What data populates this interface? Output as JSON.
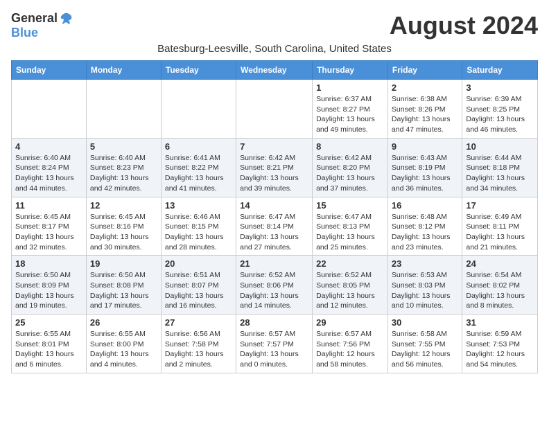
{
  "header": {
    "logo_general": "General",
    "logo_blue": "Blue",
    "month_title": "August 2024",
    "location": "Batesburg-Leesville, South Carolina, United States"
  },
  "days_of_week": [
    "Sunday",
    "Monday",
    "Tuesday",
    "Wednesday",
    "Thursday",
    "Friday",
    "Saturday"
  ],
  "weeks": [
    [
      {
        "day": "",
        "info": ""
      },
      {
        "day": "",
        "info": ""
      },
      {
        "day": "",
        "info": ""
      },
      {
        "day": "",
        "info": ""
      },
      {
        "day": "1",
        "info": "Sunrise: 6:37 AM\nSunset: 8:27 PM\nDaylight: 13 hours\nand 49 minutes."
      },
      {
        "day": "2",
        "info": "Sunrise: 6:38 AM\nSunset: 8:26 PM\nDaylight: 13 hours\nand 47 minutes."
      },
      {
        "day": "3",
        "info": "Sunrise: 6:39 AM\nSunset: 8:25 PM\nDaylight: 13 hours\nand 46 minutes."
      }
    ],
    [
      {
        "day": "4",
        "info": "Sunrise: 6:40 AM\nSunset: 8:24 PM\nDaylight: 13 hours\nand 44 minutes."
      },
      {
        "day": "5",
        "info": "Sunrise: 6:40 AM\nSunset: 8:23 PM\nDaylight: 13 hours\nand 42 minutes."
      },
      {
        "day": "6",
        "info": "Sunrise: 6:41 AM\nSunset: 8:22 PM\nDaylight: 13 hours\nand 41 minutes."
      },
      {
        "day": "7",
        "info": "Sunrise: 6:42 AM\nSunset: 8:21 PM\nDaylight: 13 hours\nand 39 minutes."
      },
      {
        "day": "8",
        "info": "Sunrise: 6:42 AM\nSunset: 8:20 PM\nDaylight: 13 hours\nand 37 minutes."
      },
      {
        "day": "9",
        "info": "Sunrise: 6:43 AM\nSunset: 8:19 PM\nDaylight: 13 hours\nand 36 minutes."
      },
      {
        "day": "10",
        "info": "Sunrise: 6:44 AM\nSunset: 8:18 PM\nDaylight: 13 hours\nand 34 minutes."
      }
    ],
    [
      {
        "day": "11",
        "info": "Sunrise: 6:45 AM\nSunset: 8:17 PM\nDaylight: 13 hours\nand 32 minutes."
      },
      {
        "day": "12",
        "info": "Sunrise: 6:45 AM\nSunset: 8:16 PM\nDaylight: 13 hours\nand 30 minutes."
      },
      {
        "day": "13",
        "info": "Sunrise: 6:46 AM\nSunset: 8:15 PM\nDaylight: 13 hours\nand 28 minutes."
      },
      {
        "day": "14",
        "info": "Sunrise: 6:47 AM\nSunset: 8:14 PM\nDaylight: 13 hours\nand 27 minutes."
      },
      {
        "day": "15",
        "info": "Sunrise: 6:47 AM\nSunset: 8:13 PM\nDaylight: 13 hours\nand 25 minutes."
      },
      {
        "day": "16",
        "info": "Sunrise: 6:48 AM\nSunset: 8:12 PM\nDaylight: 13 hours\nand 23 minutes."
      },
      {
        "day": "17",
        "info": "Sunrise: 6:49 AM\nSunset: 8:11 PM\nDaylight: 13 hours\nand 21 minutes."
      }
    ],
    [
      {
        "day": "18",
        "info": "Sunrise: 6:50 AM\nSunset: 8:09 PM\nDaylight: 13 hours\nand 19 minutes."
      },
      {
        "day": "19",
        "info": "Sunrise: 6:50 AM\nSunset: 8:08 PM\nDaylight: 13 hours\nand 17 minutes."
      },
      {
        "day": "20",
        "info": "Sunrise: 6:51 AM\nSunset: 8:07 PM\nDaylight: 13 hours\nand 16 minutes."
      },
      {
        "day": "21",
        "info": "Sunrise: 6:52 AM\nSunset: 8:06 PM\nDaylight: 13 hours\nand 14 minutes."
      },
      {
        "day": "22",
        "info": "Sunrise: 6:52 AM\nSunset: 8:05 PM\nDaylight: 13 hours\nand 12 minutes."
      },
      {
        "day": "23",
        "info": "Sunrise: 6:53 AM\nSunset: 8:03 PM\nDaylight: 13 hours\nand 10 minutes."
      },
      {
        "day": "24",
        "info": "Sunrise: 6:54 AM\nSunset: 8:02 PM\nDaylight: 13 hours\nand 8 minutes."
      }
    ],
    [
      {
        "day": "25",
        "info": "Sunrise: 6:55 AM\nSunset: 8:01 PM\nDaylight: 13 hours\nand 6 minutes."
      },
      {
        "day": "26",
        "info": "Sunrise: 6:55 AM\nSunset: 8:00 PM\nDaylight: 13 hours\nand 4 minutes."
      },
      {
        "day": "27",
        "info": "Sunrise: 6:56 AM\nSunset: 7:58 PM\nDaylight: 13 hours\nand 2 minutes."
      },
      {
        "day": "28",
        "info": "Sunrise: 6:57 AM\nSunset: 7:57 PM\nDaylight: 13 hours\nand 0 minutes."
      },
      {
        "day": "29",
        "info": "Sunrise: 6:57 AM\nSunset: 7:56 PM\nDaylight: 12 hours\nand 58 minutes."
      },
      {
        "day": "30",
        "info": "Sunrise: 6:58 AM\nSunset: 7:55 PM\nDaylight: 12 hours\nand 56 minutes."
      },
      {
        "day": "31",
        "info": "Sunrise: 6:59 AM\nSunset: 7:53 PM\nDaylight: 12 hours\nand 54 minutes."
      }
    ]
  ]
}
